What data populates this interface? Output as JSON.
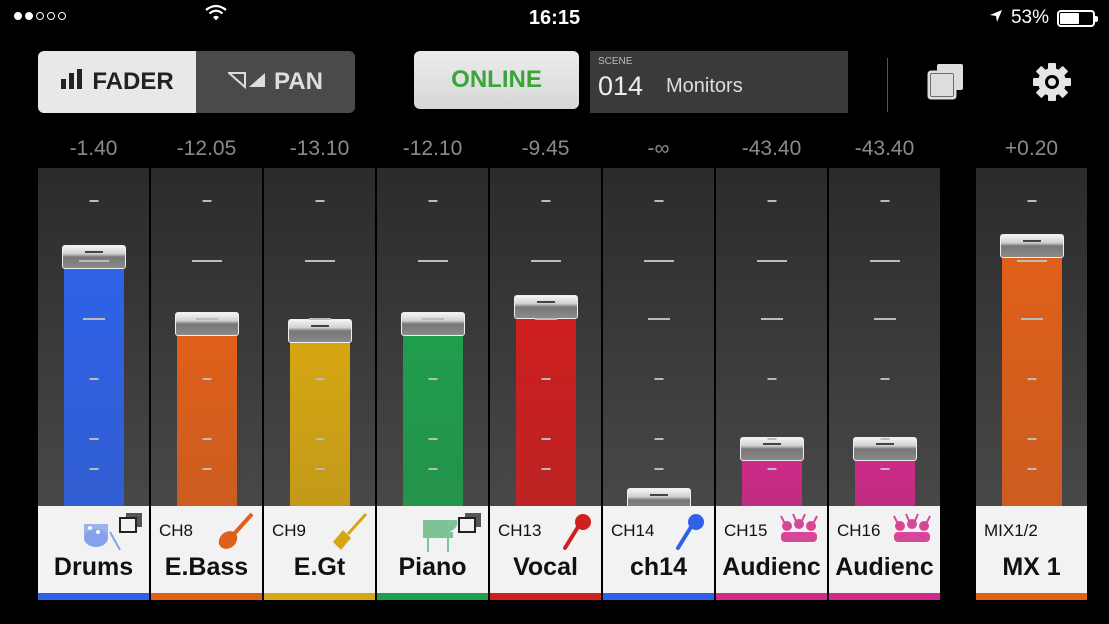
{
  "status": {
    "time": "16:15",
    "battery": "53%"
  },
  "toolbar": {
    "fader_label": "FADER",
    "pan_label": "PAN",
    "online_label": "ONLINE",
    "scene_caption": "SCENE",
    "scene_number": "014",
    "scene_name": "Monitors"
  },
  "channels": [
    {
      "value": "-1.40",
      "ch": "",
      "name": "Drums",
      "color": "#2f62e8",
      "level": 0.72,
      "icon": "drums-icon"
    },
    {
      "value": "-12.05",
      "ch": "CH8",
      "name": "E.Bass",
      "color": "#e0601a",
      "level": 0.52,
      "icon": "bass-guitar-icon"
    },
    {
      "value": "-13.10",
      "ch": "CH9",
      "name": "E.Gt",
      "color": "#d6a712",
      "level": 0.5,
      "icon": "electric-guitar-icon"
    },
    {
      "value": "-12.10",
      "ch": "",
      "name": "Piano",
      "color": "#1f9e4c",
      "level": 0.52,
      "icon": "piano-icon"
    },
    {
      "value": "-9.45",
      "ch": "CH13",
      "name": "Vocal",
      "color": "#cf1f1f",
      "level": 0.57,
      "icon": "microphone-icon"
    },
    {
      "value": "-∞",
      "ch": "CH14",
      "name": "ch14",
      "color": "#2f62e8",
      "level": 0.0,
      "icon": "microphone-icon"
    },
    {
      "value": "-43.40",
      "ch": "CH15",
      "name": "Audienc",
      "color": "#d02a8a",
      "level": 0.15,
      "icon": "audience-icon"
    },
    {
      "value": "-43.40",
      "ch": "CH16",
      "name": "Audienc",
      "color": "#d02a8a",
      "level": 0.15,
      "icon": "audience-icon"
    },
    {
      "value": "+0.20",
      "ch": "MIX1/2",
      "name": "MX 1",
      "color": "#e0601a",
      "level": 0.75,
      "icon": ""
    }
  ]
}
